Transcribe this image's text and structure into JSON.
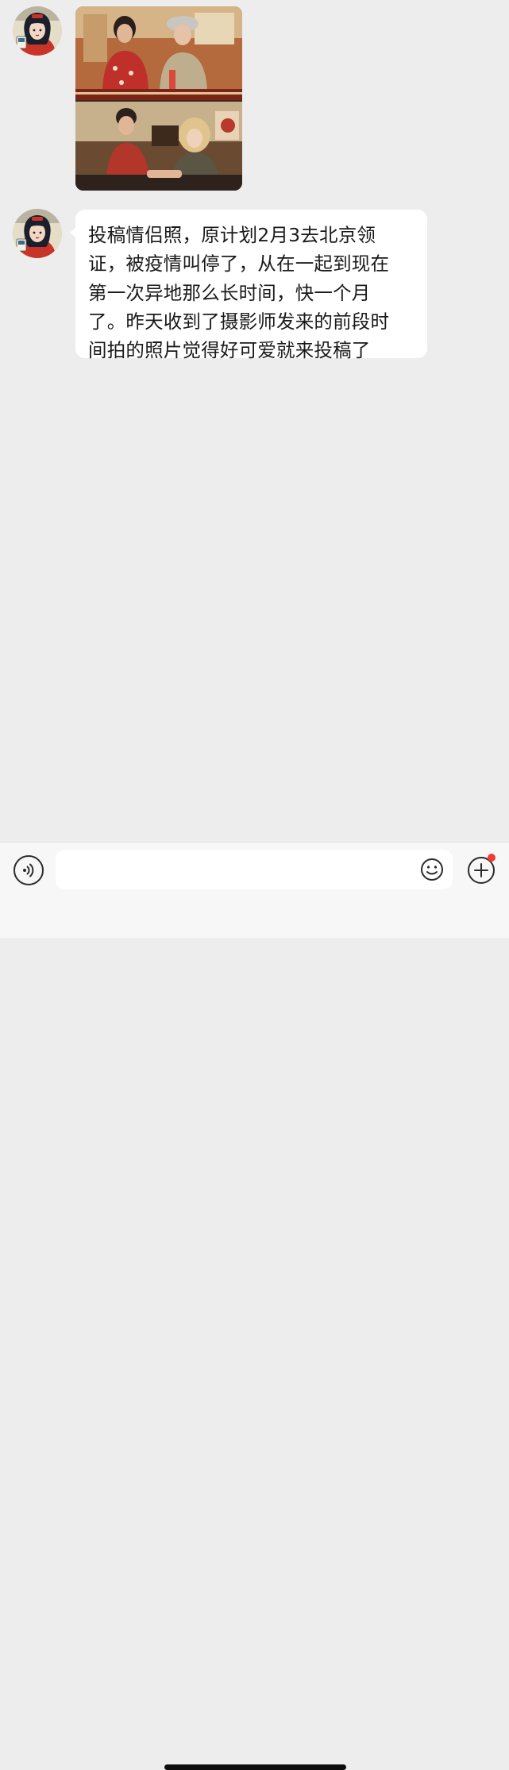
{
  "chat": {
    "messages": [
      {
        "sender": "other",
        "type": "image",
        "avatar": "avatar-illustration"
      },
      {
        "sender": "other",
        "type": "text",
        "avatar": "avatar-illustration",
        "text": "投稿情侣照，原计划2月3去北京领\n证，被疫情叫停了，从在一起到现在\n第一次异地那么长时间，快一个月\n了。昨天收到了摄影师发来的前段时\n间拍的照片觉得好可爱就来投稿了"
      }
    ]
  },
  "input_bar": {
    "input_value": "",
    "icons": {
      "voice": "voice-icon",
      "emoji": "emoji-icon",
      "plus": "plus-icon"
    },
    "notification_dot_color": "#f23b2f"
  },
  "colors": {
    "chat_background": "#ededed",
    "bubble_background": "#ffffff",
    "input_bar_background": "#f7f7f7"
  }
}
